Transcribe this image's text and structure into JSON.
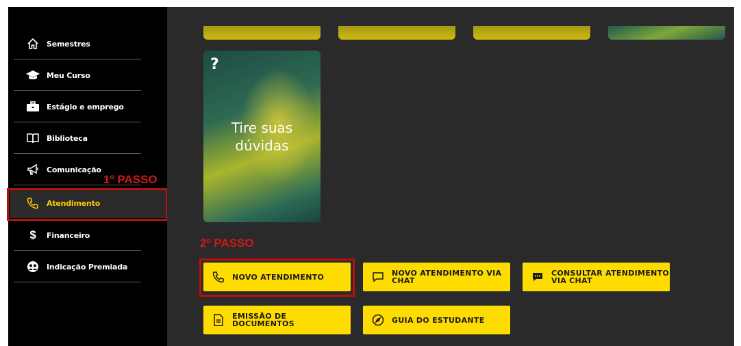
{
  "sidebar": {
    "items": [
      {
        "label": "Semestres",
        "icon": "home-icon"
      },
      {
        "label": "Meu Curso",
        "icon": "graduation-cap-icon"
      },
      {
        "label": "Estágio e emprego",
        "icon": "briefcase-icon"
      },
      {
        "label": "Biblioteca",
        "icon": "book-icon"
      },
      {
        "label": "Comunicação",
        "icon": "megaphone-icon"
      },
      {
        "label": "Atendimento",
        "icon": "phone-icon",
        "active": true
      },
      {
        "label": "Financeiro",
        "icon": "dollar-icon"
      },
      {
        "label": "Indicação Premiada",
        "icon": "users-icon"
      }
    ]
  },
  "annotations": {
    "step1": "1º PASSO",
    "step2": "2º PASSO",
    "color": "#d01818"
  },
  "card": {
    "badge": "?",
    "title_line1": "Tire suas",
    "title_line2": "dúvidas"
  },
  "actions": [
    {
      "label": "NOVO ATENDIMENTO",
      "icon": "phone-icon"
    },
    {
      "label_line1": "NOVO ATENDIMENTO VIA",
      "label_line2": "CHAT",
      "icon": "chat-bubble-icon"
    },
    {
      "label_line1": "CONSULTAR ATENDIMENTO",
      "label_line2": "VIA CHAT",
      "icon": "chat-dots-icon"
    },
    {
      "label": "EMISSÃO DE DOCUMENTOS",
      "icon": "document-icon"
    },
    {
      "label": "GUIA DO ESTUDANTE",
      "icon": "compass-icon"
    }
  ],
  "colors": {
    "accent": "#ffdc00",
    "sidebar_bg": "#000000",
    "main_bg": "#2a2a2a"
  }
}
